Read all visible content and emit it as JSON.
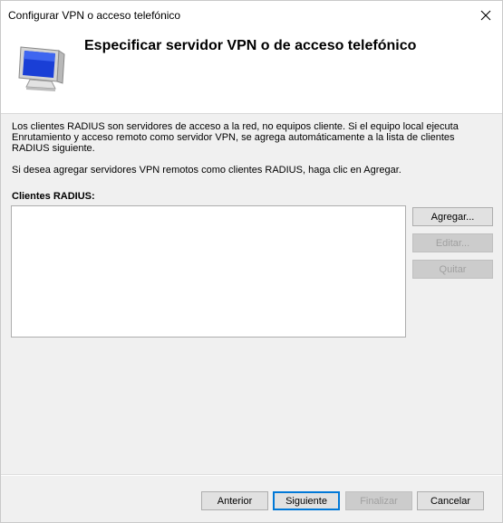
{
  "window": {
    "title": "Configurar VPN o acceso telefónico"
  },
  "header": {
    "heading": "Especificar servidor VPN o de acceso telefónico",
    "icon": "monitor-icon"
  },
  "body": {
    "paragraph1": "Los clientes RADIUS son servidores de acceso a la red, no equipos cliente. Si el equipo local ejecuta Enrutamiento y acceso remoto como servidor VPN, se agrega automáticamente a la lista de clientes RADIUS  siguiente.",
    "paragraph1_lines": [
      "Los clientes RADIUS son servidores de acceso a la red, no equipos cliente. Si el equipo local ejecuta",
      "Enrutamiento y acceso remoto como servidor VPN, se agrega automáticamente a la lista de clientes",
      "RADIUS  siguiente."
    ],
    "paragraph2": "Si desea agregar servidores VPN remotos como clientes RADIUS, haga clic en Agregar.",
    "list_label": "Clientes RADIUS:",
    "list_items": []
  },
  "side_buttons": {
    "add": "Agregar...",
    "edit": "Editar...",
    "remove": "Quitar"
  },
  "footer": {
    "back": "Anterior",
    "next": "Siguiente",
    "finish": "Finalizar",
    "cancel": "Cancelar"
  },
  "colors": {
    "window_bg": "#f0f0f0",
    "header_bg": "#ffffff",
    "focus_border": "#0078d7",
    "disabled_text": "#a0a0a0"
  }
}
